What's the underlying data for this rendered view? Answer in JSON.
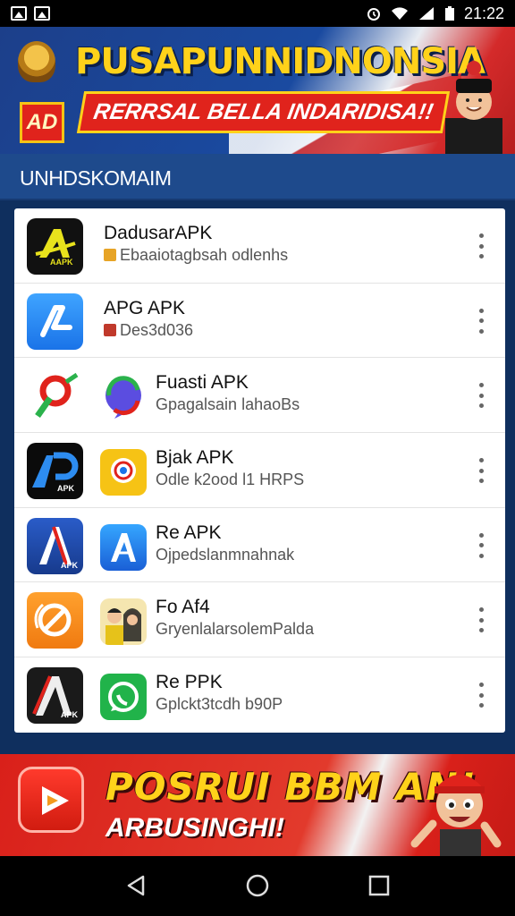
{
  "status_bar": {
    "time": "21:22",
    "icons": [
      "image-icon",
      "image-icon",
      "alarm-icon",
      "wifi-icon",
      "signal-icon",
      "battery-icon"
    ]
  },
  "top_banner": {
    "title": "PUSAPUNNIDNONSIA",
    "subtitle": "RERRSAL BELLA INDARIDISA!!",
    "logo_text": "AD"
  },
  "section": {
    "title": "UNHDSKOMAIM"
  },
  "apps": [
    {
      "name": "DadusarAPK",
      "subtitle": "Ebaaiotagbsah odlenhs",
      "icon": "yellow-a-icon",
      "icon_text": "AAPK"
    },
    {
      "name": "APG APK",
      "subtitle": "Des3d036",
      "icon": "blue-a-icon"
    },
    {
      "name": "Fuasti APK",
      "subtitle": "Gpagalsain lahaoBs",
      "icon": "maps-pin-icon",
      "icon2": "chat-bubble-icon"
    },
    {
      "name": "Bjak APK",
      "subtitle": "Odle k2ood l1 HRPS",
      "icon": "ap-logo-icon",
      "icon2": "yellow-chat-icon",
      "icon_text": "APK"
    },
    {
      "name": "Re APK",
      "subtitle": "Ojpedslanmnahnak",
      "icon": "blue-triangle-a-icon",
      "icon2": "appstore-icon",
      "icon_text": "APK"
    },
    {
      "name": "Fo Af4",
      "subtitle": "GryenlalarsolemPalda",
      "icon": "orange-compass-icon",
      "icon2": "people-avatar-icon"
    },
    {
      "name": "Re PPK",
      "subtitle": "Gplckt3tcdh b90P",
      "icon": "black-a-icon",
      "icon2": "whatsapp-icon",
      "icon_text": "APK"
    }
  ],
  "bottom_banner": {
    "title": "POSRUI BBM AN!",
    "subtitle": "ARBUSINGHI!"
  },
  "nav": {
    "buttons": [
      "back-icon",
      "home-icon",
      "recents-icon"
    ]
  },
  "colors": {
    "header_blue": "#1e4a8c",
    "banner_yellow": "#ffd21a",
    "banner_red": "#e0231c"
  }
}
